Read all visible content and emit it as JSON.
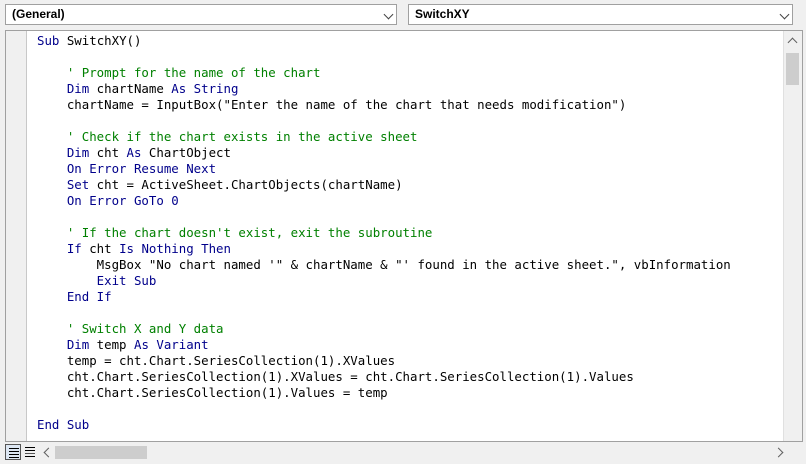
{
  "object_combo": {
    "value": "(General)"
  },
  "procedure_combo": {
    "value": "SwitchXY"
  },
  "code_lines": [
    [
      {
        "t": "Sub",
        "c": "kw"
      },
      {
        "t": " SwitchXY()",
        "c": ""
      }
    ],
    [],
    [
      {
        "t": "    ' Prompt for the name of the chart",
        "c": "cm"
      }
    ],
    [
      {
        "t": "    Dim",
        "c": "kw"
      },
      {
        "t": " chartName ",
        "c": ""
      },
      {
        "t": "As String",
        "c": "kw"
      }
    ],
    [
      {
        "t": "    chartName = InputBox(\"Enter the name of the chart that needs modification\")",
        "c": ""
      }
    ],
    [],
    [
      {
        "t": "    ' Check if the chart exists in the active sheet",
        "c": "cm"
      }
    ],
    [
      {
        "t": "    Dim",
        "c": "kw"
      },
      {
        "t": " cht ",
        "c": ""
      },
      {
        "t": "As",
        "c": "kw"
      },
      {
        "t": " ChartObject",
        "c": ""
      }
    ],
    [
      {
        "t": "    On Error Resume Next",
        "c": "kw"
      }
    ],
    [
      {
        "t": "    Set",
        "c": "kw"
      },
      {
        "t": " cht = ActiveSheet.ChartObjects(chartName)",
        "c": ""
      }
    ],
    [
      {
        "t": "    On Error GoTo 0",
        "c": "kw"
      }
    ],
    [],
    [
      {
        "t": "    ' If the chart doesn't exist, exit the subroutine",
        "c": "cm"
      }
    ],
    [
      {
        "t": "    If",
        "c": "kw"
      },
      {
        "t": " cht ",
        "c": ""
      },
      {
        "t": "Is Nothing Then",
        "c": "kw"
      }
    ],
    [
      {
        "t": "        MsgBox \"No chart named '\" & chartName & \"' found in the active sheet.\", vbInformation",
        "c": ""
      }
    ],
    [
      {
        "t": "        Exit Sub",
        "c": "kw"
      }
    ],
    [
      {
        "t": "    End If",
        "c": "kw"
      }
    ],
    [],
    [
      {
        "t": "    ' Switch X and Y data",
        "c": "cm"
      }
    ],
    [
      {
        "t": "    Dim",
        "c": "kw"
      },
      {
        "t": " temp ",
        "c": ""
      },
      {
        "t": "As Variant",
        "c": "kw"
      }
    ],
    [
      {
        "t": "    temp = cht.Chart.SeriesCollection(1).XValues",
        "c": ""
      }
    ],
    [
      {
        "t": "    cht.Chart.SeriesCollection(1).XValues = cht.Chart.SeriesCollection(1).Values",
        "c": ""
      }
    ],
    [
      {
        "t": "    cht.Chart.SeriesCollection(1).Values = temp",
        "c": ""
      }
    ],
    [],
    [
      {
        "t": "End Sub",
        "c": "kw"
      }
    ]
  ],
  "colors": {
    "keyword": "#00008b",
    "comment": "#008000",
    "text": "#000000"
  },
  "icons": {
    "dropdown": "chevron-down-icon",
    "procedure_view": "procedure-view-icon",
    "module_view": "full-module-view-icon"
  }
}
